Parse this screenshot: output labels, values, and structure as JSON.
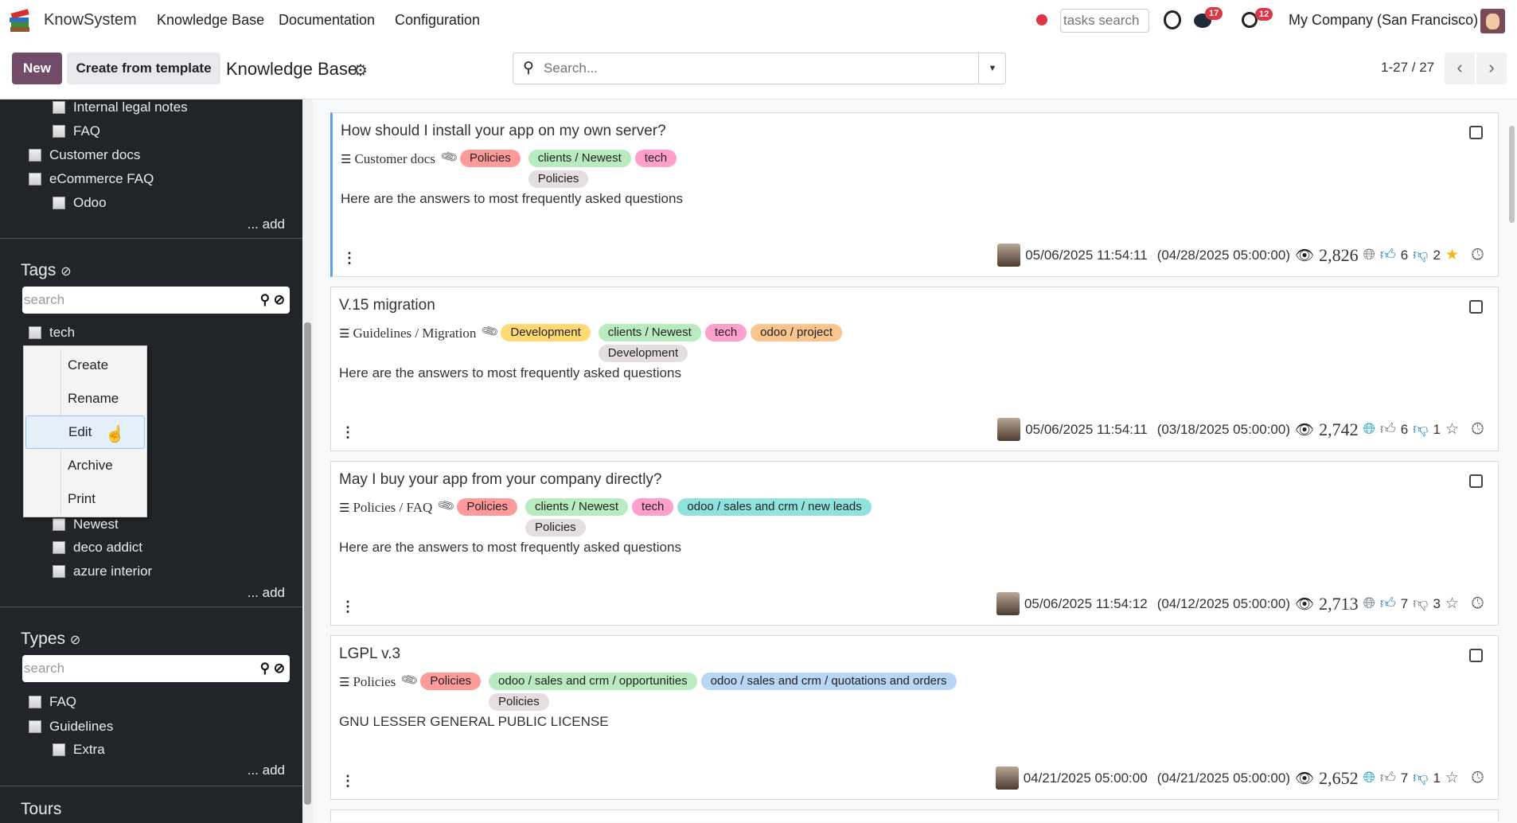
{
  "nav": {
    "app": "KnowSystem",
    "menu": [
      "Knowledge Base",
      "Documentation",
      "Configuration"
    ],
    "tasks_placeholder": "tasks search",
    "chat_count": "17",
    "activity_count": "12",
    "company": "My Company (San Francisco)"
  },
  "control": {
    "new_label": "New",
    "template_label": "Create from template",
    "title": "Knowledge Base",
    "search_placeholder": "Search...",
    "pager": "1-27 / 27"
  },
  "sidebar": {
    "sections": {
      "items": [
        {
          "label": "Internal legal notes",
          "level": 2
        },
        {
          "label": "FAQ",
          "level": 2
        },
        {
          "label": "Customer docs",
          "level": 1
        },
        {
          "label": "eCommerce FAQ",
          "level": 1
        },
        {
          "label": "Odoo",
          "level": 2
        }
      ],
      "add": "... add"
    },
    "tags": {
      "title": "Tags",
      "placeholder": "search",
      "items": [
        {
          "label": "tech",
          "level": 1
        },
        {
          "label": "Newest",
          "level": 2
        },
        {
          "label": "deco addict",
          "level": 2
        },
        {
          "label": "azure interior",
          "level": 2
        }
      ],
      "add": "... add"
    },
    "types": {
      "title": "Types",
      "placeholder": "search",
      "items": [
        {
          "label": "FAQ",
          "level": 1
        },
        {
          "label": "Guidelines",
          "level": 1
        },
        {
          "label": "Extra",
          "level": 2
        }
      ],
      "add": "... add"
    },
    "tours": {
      "title": "Tours"
    }
  },
  "context_menu": {
    "items": [
      "Create",
      "Rename",
      "Edit",
      "Archive",
      "Print"
    ],
    "highlighted": "Edit"
  },
  "colors": {
    "primary": "#714b67",
    "sidebar": "#212529",
    "selected_border": "#5d9ee8"
  },
  "cards": [
    {
      "title": "How should I install your app on my own server?",
      "category": "Customer docs",
      "type_tag": {
        "label": "Policies",
        "color": "#ff9a9a"
      },
      "tags": [
        {
          "label": "clients / Newest",
          "color": "#b8ecbf"
        },
        {
          "label": "tech",
          "color": "#ff9fcc"
        }
      ],
      "sub_tag": {
        "label": "Policies",
        "color": "#e4dede"
      },
      "description": "Here are the answers to most frequently asked questions",
      "updated": "05/06/2025 11:54:11",
      "published": "(04/28/2025 05:00:00)",
      "views": "2,826",
      "likes": "6",
      "dislikes": "2",
      "favorite": true,
      "published_web": false,
      "liked": true,
      "disliked": true
    },
    {
      "title": "V.15 migration",
      "category": "Guidelines / Migration",
      "type_tag": {
        "label": "Development",
        "color": "#ffd972"
      },
      "tags": [
        {
          "label": "clients / Newest",
          "color": "#b8ecbf"
        },
        {
          "label": "tech",
          "color": "#ff9fcc"
        },
        {
          "label": "odoo / project",
          "color": "#f9c48d"
        }
      ],
      "sub_tag": {
        "label": "Development",
        "color": "#e4dede"
      },
      "description": "Here are the answers to most frequently asked questions",
      "updated": "05/06/2025 11:54:11",
      "published": "(03/18/2025 05:00:00)",
      "views": "2,742",
      "likes": "6",
      "dislikes": "1",
      "favorite": false,
      "published_web": true,
      "liked": false,
      "disliked": true
    },
    {
      "title": "May I buy your app from your company directly?",
      "category": "Policies / FAQ",
      "type_tag": {
        "label": "Policies",
        "color": "#ff9a9a"
      },
      "tags": [
        {
          "label": "clients / Newest",
          "color": "#b8ecbf"
        },
        {
          "label": "tech",
          "color": "#ff9fcc"
        },
        {
          "label": "odoo / sales and crm / new leads",
          "color": "#8fe3dc"
        }
      ],
      "sub_tag": {
        "label": "Policies",
        "color": "#e4dede"
      },
      "description": "Here are the answers to most frequently asked questions",
      "updated": "05/06/2025 11:54:12",
      "published": "(04/12/2025 05:00:00)",
      "views": "2,713",
      "likes": "7",
      "dislikes": "3",
      "favorite": false,
      "published_web": false,
      "liked": true,
      "disliked": false
    },
    {
      "title": "LGPL v.3",
      "category": "Policies",
      "type_tag": {
        "label": "Policies",
        "color": "#ff9a9a"
      },
      "tags": [
        {
          "label": "odoo / sales and crm / opportunities",
          "color": "#b8ecbf"
        },
        {
          "label": "odoo / sales and crm / quotations and orders",
          "color": "#b9d6f7"
        }
      ],
      "sub_tag": {
        "label": "Policies",
        "color": "#e4dede"
      },
      "description": "GNU LESSER GENERAL PUBLIC LICENSE",
      "updated": "04/21/2025 05:00:00",
      "published": "(04/21/2025 05:00:00)",
      "views": "2,652",
      "likes": "7",
      "dislikes": "1",
      "favorite": false,
      "published_web": true,
      "liked": false,
      "disliked": true
    }
  ]
}
